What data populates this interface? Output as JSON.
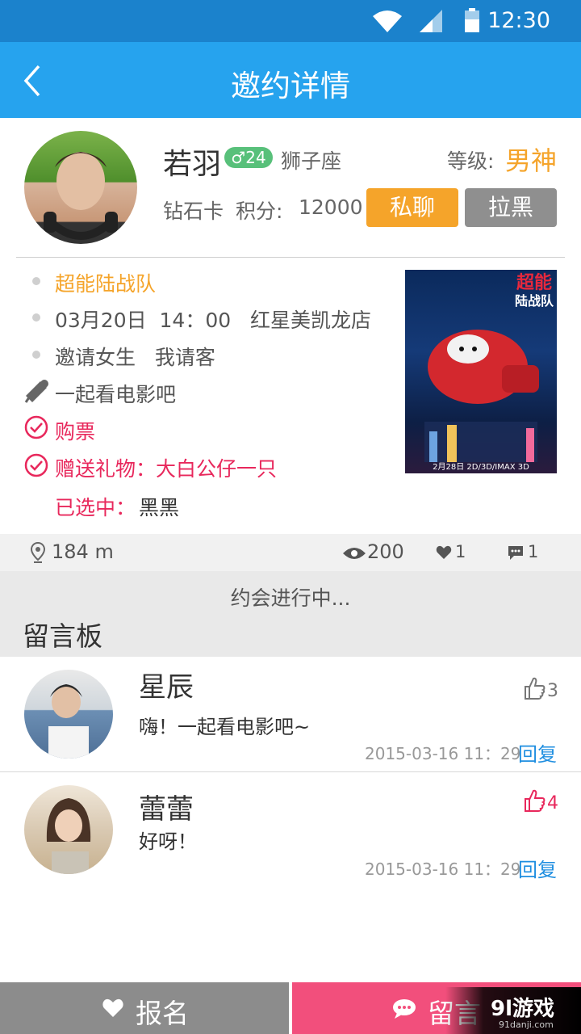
{
  "status_bar": {
    "time": "12:30"
  },
  "title_bar": {
    "title": "邀约详情"
  },
  "profile": {
    "name": "若羽",
    "gender_age": "♂24",
    "zodiac": "狮子座",
    "level_label": "等级:",
    "level_value": "男神",
    "card": "钻石卡",
    "points_label": "积分:",
    "points_value": "12000",
    "chat_button": "私聊",
    "block_button": "拉黑"
  },
  "invite": {
    "movie": "超能陆战队",
    "datetime_place": "03月20日  14：00   红星美凯龙店",
    "terms": "邀请女生   我请客",
    "slogan": "一起看电影吧",
    "ticket": "购票",
    "gift": "赠送礼物：大白公仔一只",
    "selected_label": "已选中：",
    "selected_value": "黑黑"
  },
  "poster": {
    "title_line1": "超能",
    "title_line2": "陆战队",
    "release": "2月28日 2D/3D/IMAX 3D"
  },
  "stats": {
    "distance": "184 m",
    "views": "200",
    "likes": "1",
    "comments": "1"
  },
  "progress_text": "约会进行中...",
  "message_board": {
    "title": "留言板",
    "comments": [
      {
        "name": "星辰",
        "text": "嗨！一起看电影吧~",
        "time": "2015-03-16 11：29",
        "likes": "3",
        "reply": "回复"
      },
      {
        "name": "蕾蕾",
        "text": "好呀！",
        "time": "2015-03-16 11：29",
        "likes": "4",
        "reply": "回复"
      }
    ]
  },
  "bottom": {
    "signup": "报名",
    "message": "留言",
    "watermark": "9l游戏",
    "watermark_url": "91danji.com"
  },
  "colors": {
    "primary": "#26a3ee",
    "accent_orange": "#f5a42a",
    "accent_pink": "#e8285c",
    "block_gray": "#8f8f8f"
  }
}
